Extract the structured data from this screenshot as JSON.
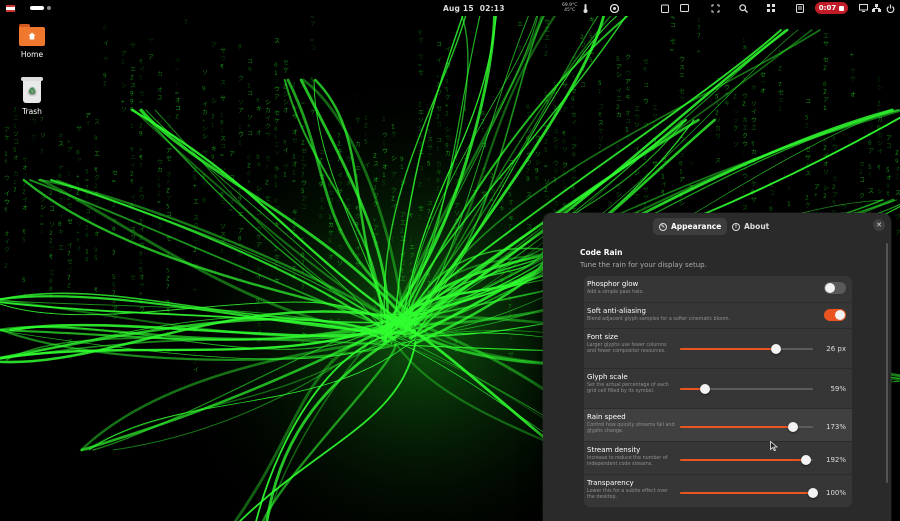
{
  "topbar": {
    "date": "Aug 15",
    "time": "02:13",
    "temperature": [
      "69.9°C",
      "45°C"
    ],
    "recording_time": "0:07"
  },
  "desktop": {
    "icons": [
      {
        "label": "Home",
        "icon": "home-folder-icon"
      },
      {
        "label": "Trash",
        "icon": "trash-icon"
      }
    ]
  },
  "window": {
    "tabs": [
      {
        "label": "Appearance",
        "icon": "appearance-icon",
        "active": true
      },
      {
        "label": "About",
        "icon": "info-icon",
        "active": false
      }
    ],
    "section_title": "Code Rain",
    "section_subtitle": "Tune the rain for your display setup.",
    "rows": [
      {
        "title": "Phosphor glow",
        "desc": "Add a simple pass halo.",
        "type": "switch",
        "on": false
      },
      {
        "title": "Soft anti-aliasing",
        "desc": "Blend adjacent glyph samples for a softer cinematic bloom.",
        "type": "switch",
        "on": true
      },
      {
        "title": "Font size",
        "desc": "Larger glyphs use fewer columns and fewer compositor resources.",
        "type": "slider",
        "fraction": 0.72,
        "value": "26 px"
      },
      {
        "title": "Glyph scale",
        "desc": "Set the actual percentage of each grid cell filled by its symbol.",
        "type": "slider",
        "fraction": 0.19,
        "value": "59%"
      },
      {
        "title": "Rain speed",
        "desc": "Control how quickly streams fall and glyphs change.",
        "type": "slider",
        "fraction": 0.85,
        "value": "173%"
      },
      {
        "title": "Stream density",
        "desc": "Increase to reduce the number of independent code streams.",
        "type": "slider",
        "fraction": 0.95,
        "value": "192%"
      },
      {
        "title": "Transparency",
        "desc": "Lower this for a subtle effect over the desktop.",
        "type": "slider",
        "fraction": 1.0,
        "value": "100%"
      }
    ]
  },
  "colors": {
    "accent": "#e95420",
    "recording": "#c01c28",
    "matrix_green": "#39ff14"
  }
}
